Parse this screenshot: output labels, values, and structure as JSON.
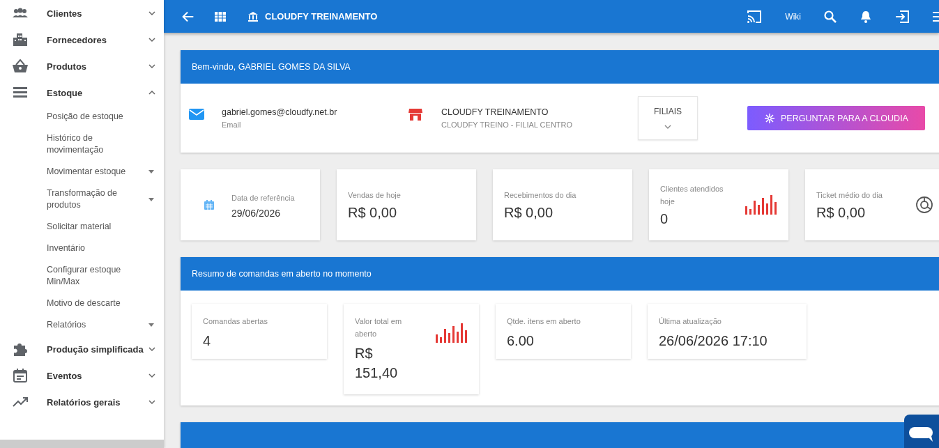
{
  "sidebar": {
    "items": [
      {
        "label": "Clientes",
        "expanded": false
      },
      {
        "label": "Fornecedores",
        "expanded": false
      },
      {
        "label": "Produtos",
        "expanded": false
      },
      {
        "label": "Estoque",
        "expanded": true,
        "children": [
          {
            "label": "Posição de estoque",
            "has_submenu": false
          },
          {
            "label": "Histórico de movimentação",
            "has_submenu": false
          },
          {
            "label": "Movimentar estoque",
            "has_submenu": true
          },
          {
            "label": "Transformação de produtos",
            "has_submenu": true
          },
          {
            "label": "Solicitar material",
            "has_submenu": false
          },
          {
            "label": "Inventário",
            "has_submenu": false
          },
          {
            "label": "Configurar estoque Min/Max",
            "has_submenu": false
          },
          {
            "label": "Motivo de descarte",
            "has_submenu": false
          },
          {
            "label": "Relatórios",
            "has_submenu": true
          }
        ]
      },
      {
        "label": "Produção simplificada",
        "expanded": false
      },
      {
        "label": "Eventos",
        "expanded": false
      },
      {
        "label": "Relatórios gerais",
        "expanded": false
      }
    ]
  },
  "topbar": {
    "title": "CLOUDFY TREINAMENTO",
    "wiki": "Wiki"
  },
  "welcome": {
    "title": "Bem-vindo, GABRIEL GOMES DA SILVA",
    "email": {
      "value": "gabriel.gomes@cloudfy.net.br",
      "label": "Email"
    },
    "company": {
      "name": "CLOUDFY TREINAMENTO",
      "branch": "CLOUDFY TREINO - FILIAL CENTRO"
    },
    "branches_label": "FILIAIS",
    "ask_button": "PERGUNTAR PARA A CLOUDIA"
  },
  "stats": [
    {
      "kind": "date",
      "label": "Data de referência",
      "value": "29/06/2026"
    },
    {
      "kind": "plain",
      "label": "Vendas de hoje",
      "value": "R$ 0,00"
    },
    {
      "kind": "plain",
      "label": "Recebimentos do dia",
      "value": "R$ 0,00"
    },
    {
      "kind": "bars",
      "label": "Clientes atendidos hoje",
      "value": "0"
    },
    {
      "kind": "donut",
      "label": "Ticket médio do dia",
      "value": "R$ 0,00"
    }
  ],
  "open_orders": {
    "title": "Resumo de comandas em aberto no momento",
    "cards": [
      {
        "kind": "plain",
        "label": "Comandas abertas",
        "value": "4"
      },
      {
        "kind": "bars",
        "label": "Valor total em aberto",
        "value": "R$ 151,40"
      },
      {
        "kind": "plain",
        "label": "Qtde. itens em aberto",
        "value": "6.00"
      },
      {
        "kind": "plain",
        "label": "Última atualização",
        "value": "26/06/2026 17:10"
      }
    ]
  }
}
